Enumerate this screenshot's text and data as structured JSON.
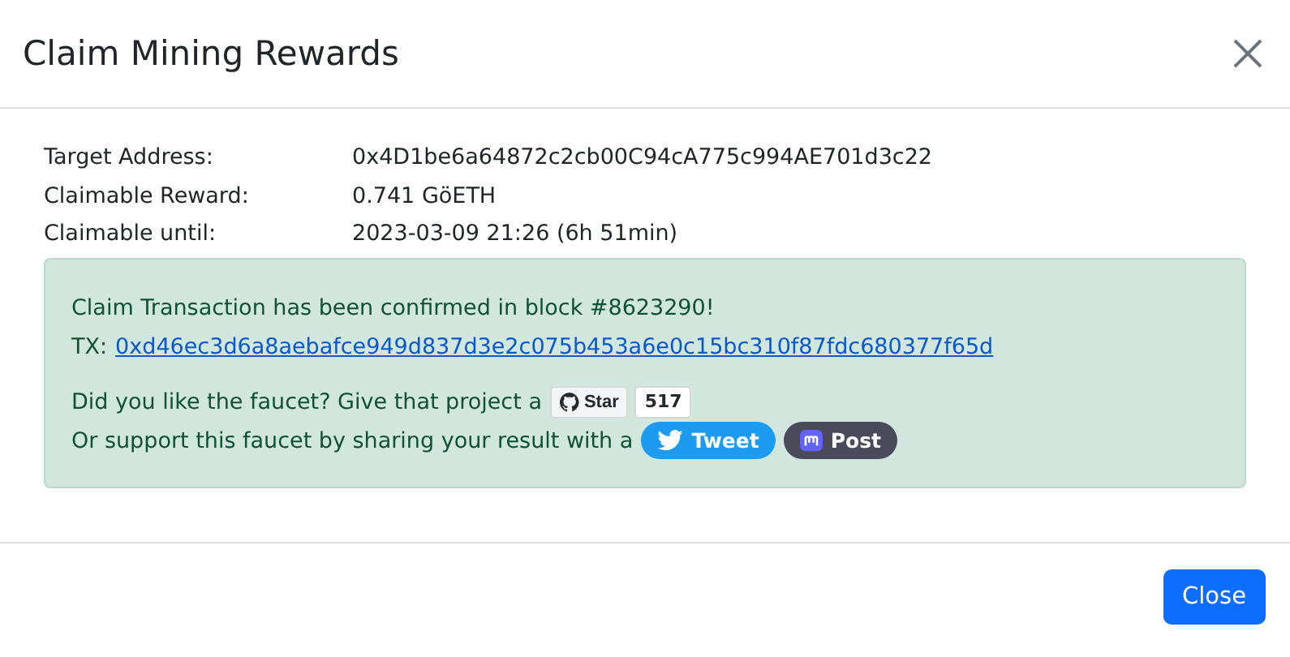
{
  "dialog": {
    "title": "Claim Mining Rewards"
  },
  "details": [
    {
      "label": "Target Address:",
      "value": "0x4D1be6a64872c2cb00C94cA775c994AE701d3c22"
    },
    {
      "label": "Claimable Reward:",
      "value": "0.741 GöETH"
    },
    {
      "label": "Claimable until:",
      "value": "2023-03-09 21:26 (6h 51min)"
    }
  ],
  "alert": {
    "message": "Claim Transaction has been confirmed in block #8623290!",
    "tx_label": "TX:",
    "tx_link": "0xd46ec3d6a8aebafce949d837d3e2c075b453a6e0c15bc310f87fdc680377f65d",
    "star_text": "Did you like the faucet? Give that project a",
    "star_button": "Star",
    "star_count": "517",
    "share_text": "Or support this faucet by sharing your result with a",
    "tweet_button": "Tweet",
    "post_button": "Post"
  },
  "buttons": [
    "Close"
  ]
}
